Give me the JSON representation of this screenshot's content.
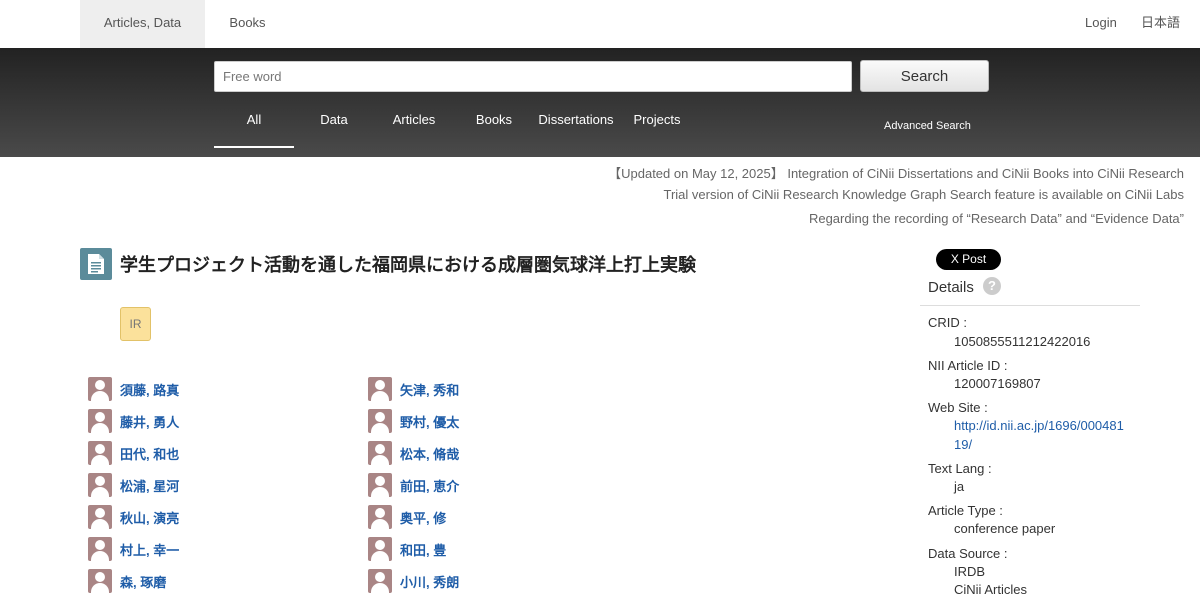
{
  "topnav": {
    "tabs": [
      "Articles, Data",
      "Books"
    ],
    "login": "Login",
    "language": "日本語"
  },
  "search": {
    "placeholder": "Free word",
    "button": "Search",
    "categories": [
      "All",
      "Data",
      "Articles",
      "Books",
      "Dissertations",
      "Projects"
    ],
    "active_category": "All",
    "advanced": "Advanced Search"
  },
  "notices": [
    "【Updated on May 12, 2025】 Integration of CiNii Dissertations and CiNii Books into CiNii Research",
    "Trial version of CiNii Research Knowledge Graph Search feature is available on CiNii Labs",
    "Regarding the recording of “Research Data” and “Evidence Data”"
  ],
  "article": {
    "title": "学生プロジェクト活動を通した福岡県における成層圏気球洋上打上実験",
    "badge": "IR",
    "authors_left": [
      "須藤, 路真",
      "藤井, 勇人",
      "田代, 和也",
      "松浦, 星河",
      "秋山, 演亮",
      "村上, 幸一",
      "森, 琢磨"
    ],
    "authors_right": [
      "矢津, 秀和",
      "野村, 優太",
      "松本, 脩哉",
      "前田, 恵介",
      "奥平, 修",
      "和田, 豊",
      "小川, 秀朗"
    ]
  },
  "sidebar": {
    "share_button": "X Post",
    "details_heading": "Details",
    "help": "?",
    "crid_label": "CRID :",
    "crid": "1050855511212422016",
    "nii_label": "NII Article ID :",
    "nii_id": "120007169807",
    "website_label": "Web Site :",
    "website": "http://id.nii.ac.jp/1696/00048119/",
    "textlang_label": "Text Lang :",
    "textlang": "ja",
    "type_label": "Article Type :",
    "type": "conference paper",
    "source_label": "Data Source :",
    "sources": [
      "IRDB",
      "CiNii Articles"
    ]
  }
}
